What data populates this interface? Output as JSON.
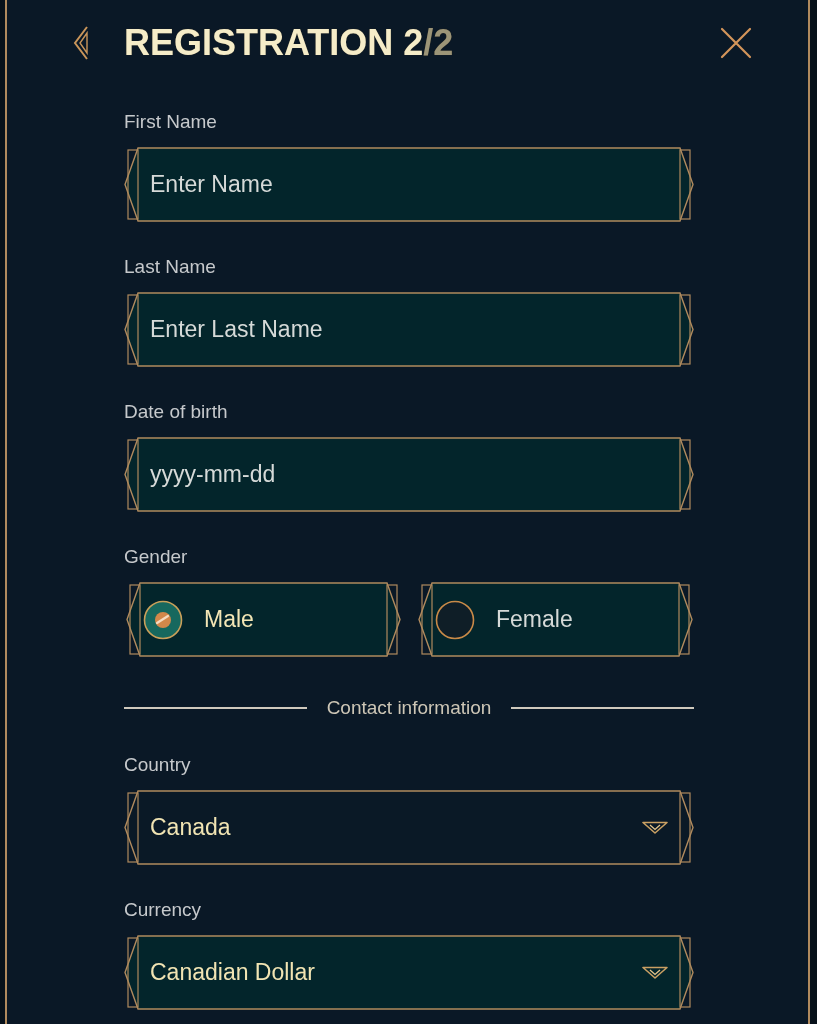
{
  "header": {
    "title": "REGISTRATION 2",
    "title_total": "/2"
  },
  "fields": [
    {
      "kind": "text",
      "label": "First Name",
      "placeholder": "Enter Name",
      "highlighted": true
    },
    {
      "kind": "text",
      "label": "Last Name",
      "placeholder": "Enter Last Name",
      "highlighted": true
    },
    {
      "kind": "text",
      "label": "Date of birth",
      "placeholder": "yyyy-mm-dd",
      "highlighted": true
    },
    {
      "kind": "radio",
      "label": "Gender",
      "options": [
        {
          "label": "Male",
          "selected": true
        },
        {
          "label": "Female",
          "selected": false
        }
      ]
    }
  ],
  "section_divider": "Contact information",
  "contact_fields": [
    {
      "kind": "select",
      "label": "Country",
      "value": "Canada",
      "highlighted": false
    },
    {
      "kind": "select",
      "label": "Currency",
      "value": "Canadian Dollar",
      "highlighted": true
    }
  ]
}
